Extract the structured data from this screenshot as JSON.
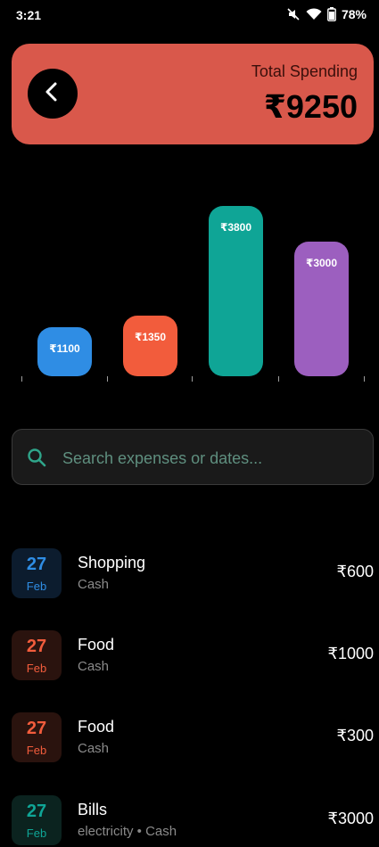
{
  "status": {
    "time": "3:21",
    "battery": "78%"
  },
  "header": {
    "total_label": "Total Spending",
    "total_amount": "₹9250",
    "accent": "#d9584b"
  },
  "chart_data": {
    "type": "bar",
    "categories": [
      "",
      "",
      "",
      ""
    ],
    "values": [
      1100,
      1350,
      3800,
      3000
    ],
    "labels": [
      "₹1100",
      "₹1350",
      "₹3800",
      "₹3000"
    ],
    "colors": [
      "#2f8de4",
      "#f25c3c",
      "#0fa596",
      "#9c5fbf"
    ],
    "ylim": [
      0,
      3800
    ],
    "grid": false
  },
  "search": {
    "placeholder": "Search expenses or dates...",
    "value": ""
  },
  "expenses": [
    {
      "day": "27",
      "month": "Feb",
      "title": "Shopping",
      "subtitle": "Cash",
      "amount": "₹600",
      "color": "#2f8de4",
      "chip_bg": "#0c1c2e"
    },
    {
      "day": "27",
      "month": "Feb",
      "title": "Food",
      "subtitle": "Cash",
      "amount": "₹1000",
      "color": "#f25c3c",
      "chip_bg": "#2a130e"
    },
    {
      "day": "27",
      "month": "Feb",
      "title": "Food",
      "subtitle": "Cash",
      "amount": "₹300",
      "color": "#f25c3c",
      "chip_bg": "#2a130e"
    },
    {
      "day": "27",
      "month": "Feb",
      "title": "Bills",
      "subtitle": "electricity  • Cash",
      "amount": "₹3000",
      "color": "#0fa596",
      "chip_bg": "#0b231f"
    }
  ]
}
